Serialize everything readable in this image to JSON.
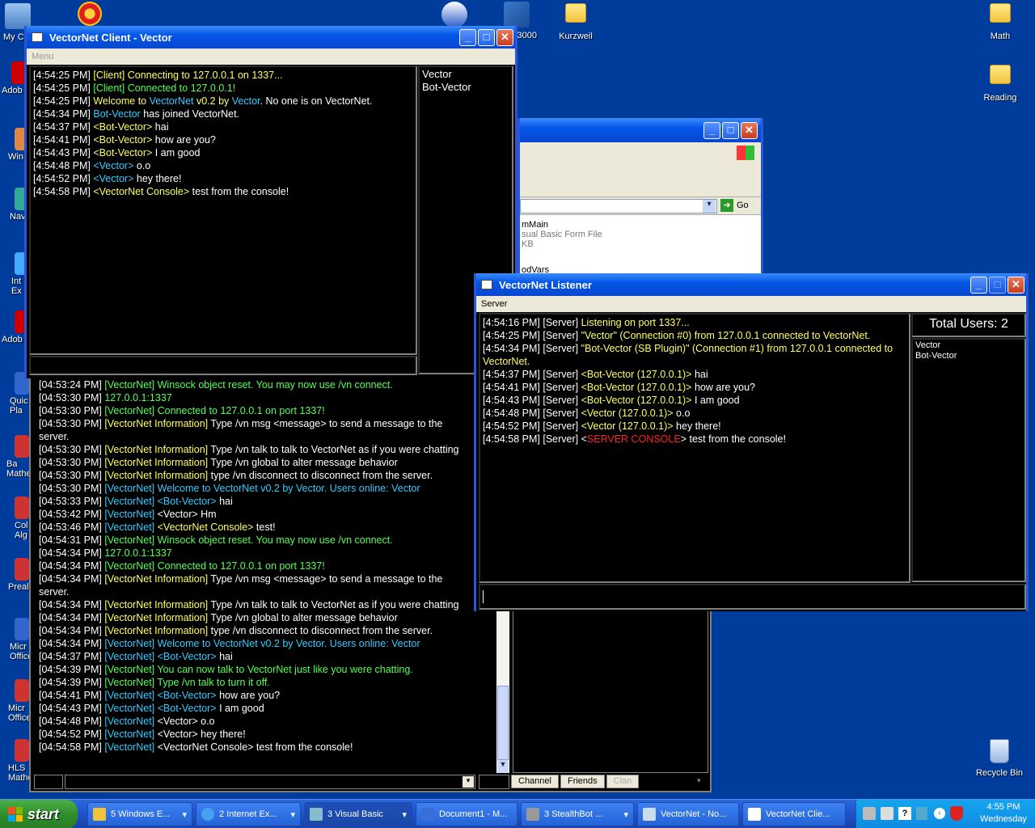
{
  "desktop": {
    "icons": [
      {
        "label": "My C"
      },
      {
        "label": "3000"
      },
      {
        "label": "Kurzweil"
      },
      {
        "label": "Math"
      },
      {
        "label": "Reading"
      },
      {
        "label": "Recycle Bin"
      }
    ],
    "edge_icons": [
      {
        "label": "Adob"
      },
      {
        "label": "Win"
      },
      {
        "label": "Nav"
      },
      {
        "label": "Int Ex"
      },
      {
        "label": "Adob"
      },
      {
        "label": "Quic Pla"
      },
      {
        "label": "Ba Mathe"
      },
      {
        "label": "Col Alg"
      },
      {
        "label": "Preal"
      },
      {
        "label": "Micr Office"
      },
      {
        "label": "Micr Office"
      },
      {
        "label": "HLS Mathe"
      }
    ]
  },
  "client_window": {
    "title": "VectorNet Client - Vector",
    "menu": "Menu",
    "users": [
      "Vector",
      "Bot-Vector"
    ],
    "log": [
      [
        {
          "t": "[4:54:25 PM] ",
          "c": "w"
        },
        {
          "t": "[Client] Connecting to 127.0.0.1 on 1337...",
          "c": "y"
        }
      ],
      [
        {
          "t": "[4:54:25 PM] ",
          "c": "w"
        },
        {
          "t": "[Client] Connected to 127.0.0.1!",
          "c": "g"
        }
      ],
      [
        {
          "t": "[4:54:25 PM] ",
          "c": "w"
        },
        {
          "t": "Welcome to ",
          "c": "y"
        },
        {
          "t": "VectorNet",
          "c": "c"
        },
        {
          "t": " v0.2 by ",
          "c": "y"
        },
        {
          "t": "Vector",
          "c": "c"
        },
        {
          "t": ". No one is on VectorNet.",
          "c": "w"
        }
      ],
      [
        {
          "t": "[4:54:34 PM] ",
          "c": "w"
        },
        {
          "t": "Bot-Vector",
          "c": "c"
        },
        {
          "t": " has joined VectorNet.",
          "c": "w"
        }
      ],
      [
        {
          "t": "[4:54:37 PM] ",
          "c": "w"
        },
        {
          "t": "<Bot-Vector>",
          "c": "y"
        },
        {
          "t": " hai",
          "c": "w"
        }
      ],
      [
        {
          "t": "[4:54:41 PM] ",
          "c": "w"
        },
        {
          "t": "<Bot-Vector>",
          "c": "y"
        },
        {
          "t": " how are you?",
          "c": "w"
        }
      ],
      [
        {
          "t": "[4:54:43 PM] ",
          "c": "w"
        },
        {
          "t": "<Bot-Vector>",
          "c": "y"
        },
        {
          "t": " I am good",
          "c": "w"
        }
      ],
      [
        {
          "t": "[4:54:48 PM] ",
          "c": "w"
        },
        {
          "t": "<Vector>",
          "c": "c"
        },
        {
          "t": " o.o",
          "c": "w"
        }
      ],
      [
        {
          "t": "[4:54:52 PM] ",
          "c": "w"
        },
        {
          "t": "<Vector>",
          "c": "c"
        },
        {
          "t": " hey there!",
          "c": "w"
        }
      ],
      [
        {
          "t": "[4:54:58 PM] ",
          "c": "w"
        },
        {
          "t": "<VectorNet Console>",
          "c": "y"
        },
        {
          "t": " test from the console!",
          "c": "w"
        }
      ]
    ]
  },
  "explorer_window": {
    "go_label": "Go",
    "file_name": "mMain",
    "file_type": "sual Basic Form File",
    "file_size": "KB",
    "file_name2": "odVars"
  },
  "stealthbot_window": {
    "log": [
      [
        {
          "t": "[04:53:24 PM] ",
          "c": "w"
        },
        {
          "t": "[VectorNet] Winsock object reset. You may now use /vn connect.",
          "c": "g"
        }
      ],
      [
        {
          "t": "[04:53:30 PM] ",
          "c": "w"
        },
        {
          "t": "127.0.0.1:1337",
          "c": "g"
        }
      ],
      [
        {
          "t": "[04:53:30 PM] ",
          "c": "w"
        },
        {
          "t": "[VectorNet] Connected to 127.0.0.1 on port 1337!",
          "c": "g"
        }
      ],
      [
        {
          "t": "[04:53:30 PM] ",
          "c": "w"
        },
        {
          "t": "[VectorNet Information] ",
          "c": "y"
        },
        {
          "t": "Type /vn msg <message> to send a message to the",
          "c": "w"
        }
      ],
      [
        {
          "t": "   server.",
          "c": "w"
        }
      ],
      [
        {
          "t": "[04:53:30 PM] ",
          "c": "w"
        },
        {
          "t": "[VectorNet Information] ",
          "c": "y"
        },
        {
          "t": "Type /vn talk to talk to VectorNet as if you were chatting",
          "c": "w"
        }
      ],
      [
        {
          "t": "[04:53:30 PM] ",
          "c": "w"
        },
        {
          "t": "[VectorNet Information] ",
          "c": "y"
        },
        {
          "t": "Type /vn global to alter message behavior",
          "c": "w"
        }
      ],
      [
        {
          "t": "[04:53:30 PM] ",
          "c": "w"
        },
        {
          "t": "[VectorNet Information] ",
          "c": "y"
        },
        {
          "t": "type /vn disconnect to disconnect from the server.",
          "c": "w"
        }
      ],
      [
        {
          "t": "[04:53:30 PM] ",
          "c": "w"
        },
        {
          "t": "[VectorNet] Welcome to VectorNet v0.2 by Vector. Users online: Vector",
          "c": "c"
        }
      ],
      [
        {
          "t": "[04:53:33 PM] ",
          "c": "w"
        },
        {
          "t": "[VectorNet] ",
          "c": "c"
        },
        {
          "t": "<Bot-Vector>",
          "c": "c"
        },
        {
          "t": " hai",
          "c": "w"
        }
      ],
      [
        {
          "t": "[04:53:42 PM] ",
          "c": "w"
        },
        {
          "t": "[VectorNet] ",
          "c": "c"
        },
        {
          "t": "<Vector> Hm",
          "c": "w"
        }
      ],
      [
        {
          "t": "[04:53:46 PM] ",
          "c": "w"
        },
        {
          "t": "[VectorNet] ",
          "c": "c"
        },
        {
          "t": "<VectorNet Console>",
          "c": "y"
        },
        {
          "t": " test!",
          "c": "w"
        }
      ],
      [
        {
          "t": "[04:54:31 PM] ",
          "c": "w"
        },
        {
          "t": "[VectorNet] Winsock object reset. You may now use /vn connect.",
          "c": "g"
        }
      ],
      [
        {
          "t": "[04:54:34 PM] ",
          "c": "w"
        },
        {
          "t": "127.0.0.1:1337",
          "c": "g"
        }
      ],
      [
        {
          "t": "[04:54:34 PM] ",
          "c": "w"
        },
        {
          "t": "[VectorNet] Connected to 127.0.0.1 on port 1337!",
          "c": "g"
        }
      ],
      [
        {
          "t": "[04:54:34 PM] ",
          "c": "w"
        },
        {
          "t": "[VectorNet Information] ",
          "c": "y"
        },
        {
          "t": "Type /vn msg <message> to send a message to the",
          "c": "w"
        }
      ],
      [
        {
          "t": "   server.",
          "c": "w"
        }
      ],
      [
        {
          "t": "[04:54:34 PM] ",
          "c": "w"
        },
        {
          "t": "[VectorNet Information] ",
          "c": "y"
        },
        {
          "t": "Type /vn talk to talk to VectorNet as if you were chatting",
          "c": "w"
        }
      ],
      [
        {
          "t": "[04:54:34 PM] ",
          "c": "w"
        },
        {
          "t": "[VectorNet Information] ",
          "c": "y"
        },
        {
          "t": "Type /vn global to alter message behavior",
          "c": "w"
        }
      ],
      [
        {
          "t": "[04:54:34 PM] ",
          "c": "w"
        },
        {
          "t": "[VectorNet Information] ",
          "c": "y"
        },
        {
          "t": "type /vn disconnect to disconnect from the server.",
          "c": "w"
        }
      ],
      [
        {
          "t": "[04:54:34 PM] ",
          "c": "w"
        },
        {
          "t": "[VectorNet] Welcome to VectorNet v0.2 by Vector. Users online: Vector",
          "c": "c"
        }
      ],
      [
        {
          "t": "[04:54:37 PM] ",
          "c": "w"
        },
        {
          "t": "[VectorNet] ",
          "c": "c"
        },
        {
          "t": "<Bot-Vector>",
          "c": "c"
        },
        {
          "t": " hai",
          "c": "w"
        }
      ],
      [
        {
          "t": "[04:54:39 PM] ",
          "c": "w"
        },
        {
          "t": "[VectorNet] You can now talk to VectorNet just like you were chatting.",
          "c": "g"
        }
      ],
      [
        {
          "t": "[04:54:39 PM] ",
          "c": "w"
        },
        {
          "t": "[VectorNet] Type /vn talk to turn it off.",
          "c": "g"
        }
      ],
      [
        {
          "t": "[04:54:41 PM] ",
          "c": "w"
        },
        {
          "t": "[VectorNet] ",
          "c": "c"
        },
        {
          "t": "<Bot-Vector>",
          "c": "c"
        },
        {
          "t": " how are you?",
          "c": "w"
        }
      ],
      [
        {
          "t": "[04:54:43 PM] ",
          "c": "w"
        },
        {
          "t": "[VectorNet] ",
          "c": "c"
        },
        {
          "t": "<Bot-Vector>",
          "c": "c"
        },
        {
          "t": " I am good",
          "c": "w"
        }
      ],
      [
        {
          "t": "[04:54:48 PM] ",
          "c": "w"
        },
        {
          "t": "[VectorNet] ",
          "c": "c"
        },
        {
          "t": "<Vector> o.o",
          "c": "w"
        }
      ],
      [
        {
          "t": "[04:54:52 PM] ",
          "c": "w"
        },
        {
          "t": "[VectorNet] ",
          "c": "c"
        },
        {
          "t": "<Vector> hey there!",
          "c": "w"
        }
      ],
      [
        {
          "t": "[04:54:58 PM] ",
          "c": "w"
        },
        {
          "t": "[VectorNet] ",
          "c": "c"
        },
        {
          "t": "<VectorNet Console> test from the console!",
          "c": "w"
        }
      ]
    ],
    "tabs": [
      "Channel",
      "Friends",
      "Clan"
    ]
  },
  "listener_window": {
    "title": "VectorNet Listener",
    "menu": "Server",
    "total_users": "Total Users: 2",
    "users": [
      "Vector",
      "Bot-Vector"
    ],
    "log": [
      [
        {
          "t": "[4:54:16 PM] [Server] ",
          "c": "w"
        },
        {
          "t": "Listening on port 1337...",
          "c": "y"
        }
      ],
      [
        {
          "t": "[4:54:25 PM] [Server] ",
          "c": "w"
        },
        {
          "t": "\"Vector\" (Connection #0) from 127.0.0.1 connected  to VectorNet.",
          "c": "y"
        }
      ],
      [
        {
          "t": "[4:54:34 PM] [Server] ",
          "c": "w"
        },
        {
          "t": "\"Bot-Vector (SB Plugin)\" (Connection #1) from 127.0.0.1 connected  to",
          "c": "y"
        }
      ],
      [
        {
          "t": "VectorNet.",
          "c": "y"
        }
      ],
      [
        {
          "t": "[4:54:37 PM] [Server] ",
          "c": "w"
        },
        {
          "t": "<Bot-Vector (127.0.0.1)>",
          "c": "y"
        },
        {
          "t": " hai",
          "c": "w"
        }
      ],
      [
        {
          "t": "[4:54:41 PM] [Server] ",
          "c": "w"
        },
        {
          "t": "<Bot-Vector (127.0.0.1)>",
          "c": "y"
        },
        {
          "t": " how are you?",
          "c": "w"
        }
      ],
      [
        {
          "t": "[4:54:43 PM] [Server] ",
          "c": "w"
        },
        {
          "t": "<Bot-Vector (127.0.0.1)>",
          "c": "y"
        },
        {
          "t": " I am good",
          "c": "w"
        }
      ],
      [
        {
          "t": "[4:54:48 PM] [Server] ",
          "c": "w"
        },
        {
          "t": "<Vector (127.0.0.1)>",
          "c": "y"
        },
        {
          "t": " o.o",
          "c": "w"
        }
      ],
      [
        {
          "t": "[4:54:52 PM] [Server] ",
          "c": "w"
        },
        {
          "t": "<Vector (127.0.0.1)>",
          "c": "y"
        },
        {
          "t": " hey there!",
          "c": "w"
        }
      ],
      [
        {
          "t": "[4:54:58 PM] [Server] ",
          "c": "w"
        },
        {
          "t": "<",
          "c": "w"
        },
        {
          "t": "SERVER CONSOLE",
          "c": "r"
        },
        {
          "t": ">",
          "c": "w"
        },
        {
          "t": " test from the console!",
          "c": "w"
        }
      ]
    ]
  },
  "taskbar": {
    "start_label": "start",
    "buttons": [
      {
        "label": "5 Windows E...",
        "icon": "folder-icon"
      },
      {
        "label": "2 Internet Ex...",
        "icon": "ie-icon"
      },
      {
        "label": "3 Visual Basic",
        "icon": "vb-icon"
      },
      {
        "label": "Document1 - M...",
        "icon": "word-icon"
      },
      {
        "label": "3 StealthBot ...",
        "icon": "stealthbot-icon"
      },
      {
        "label": "VectorNet - No...",
        "icon": "notepad-icon"
      },
      {
        "label": "VectorNet Clie...",
        "icon": "app-icon"
      }
    ],
    "clock_time": "4:55 PM",
    "clock_day": "Wednesday"
  }
}
